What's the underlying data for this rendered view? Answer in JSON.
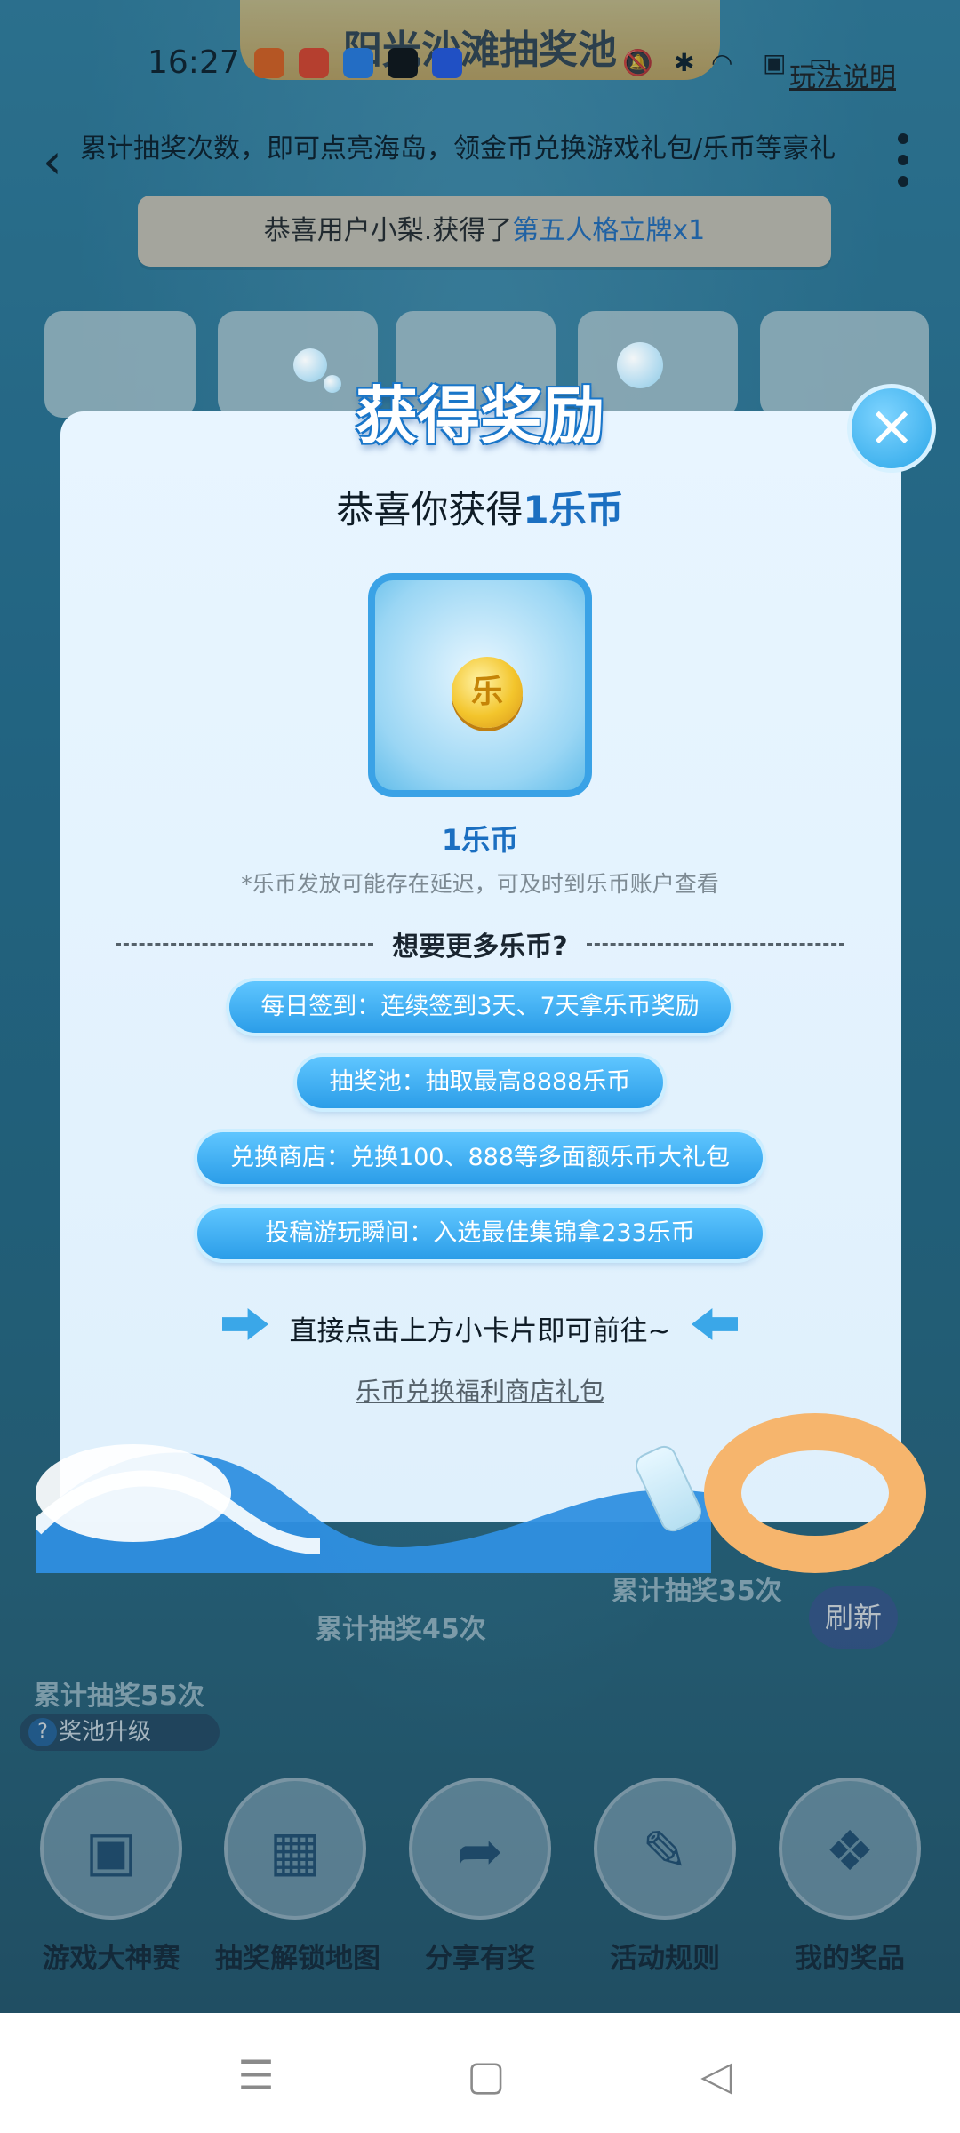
{
  "status_bar": {
    "time": "16:27",
    "app_icons": [
      "kuaishou-icon",
      "video-icon",
      "browser-icon",
      "tiktok-icon",
      "baidu-icon"
    ],
    "right_icons": [
      "mute-icon",
      "bluetooth-icon",
      "wifi-icon",
      "signal-icon",
      "battery-icon"
    ]
  },
  "header": {
    "title": "阳光沙滩抽奖池",
    "rules_link": "玩法说明",
    "subtitle": "累计抽奖次数，即可点亮海岛，领金币兑换游戏礼包/乐币等豪礼"
  },
  "ticker": {
    "prefix": "恭喜用户小梨.获得了",
    "highlight": "第五人格立牌x1"
  },
  "modal": {
    "title": "获得奖励",
    "congrats_prefix": "恭喜你获得",
    "congrats_amount": "1乐币",
    "reward_label": "1乐币",
    "coin_glyph": "乐",
    "note": "*乐币发放可能存在延迟，可及时到乐币账户查看",
    "more_heading": "想要更多乐币?",
    "pills": [
      "每日签到：连续签到3天、7天拿乐币奖励",
      "抽奖池：抽取最高8888乐币",
      "兑换商店：兑换100、888等多面额乐币大礼包",
      "投稿游玩瞬间：入选最佳集锦拿233乐币"
    ],
    "hint": "直接点击上方小卡片即可前往~",
    "shop_link": "乐币兑换福利商店礼包",
    "close_icon": "close-icon"
  },
  "background": {
    "milestone_35": "累计抽奖35次",
    "milestone_45": "累计抽奖45次",
    "milestone_55": "累计抽奖55次",
    "refresh": "刷新",
    "upgrade": "奖池升级",
    "upgrade_icon": "?"
  },
  "bottom_nav": [
    {
      "label": "游戏大神赛",
      "icon": "tv-icon"
    },
    {
      "label": "抽奖解锁地图",
      "icon": "map-icon"
    },
    {
      "label": "分享有奖",
      "icon": "share-icon"
    },
    {
      "label": "活动规则",
      "icon": "book-icon"
    },
    {
      "label": "我的奖品",
      "icon": "gift-icon"
    }
  ],
  "system_nav": [
    "menu-icon",
    "home-icon",
    "back-icon"
  ],
  "colors": {
    "accent": "#2a9de8",
    "highlight_text": "#1b6fc1",
    "modal_bg": "#e3f2fd"
  }
}
